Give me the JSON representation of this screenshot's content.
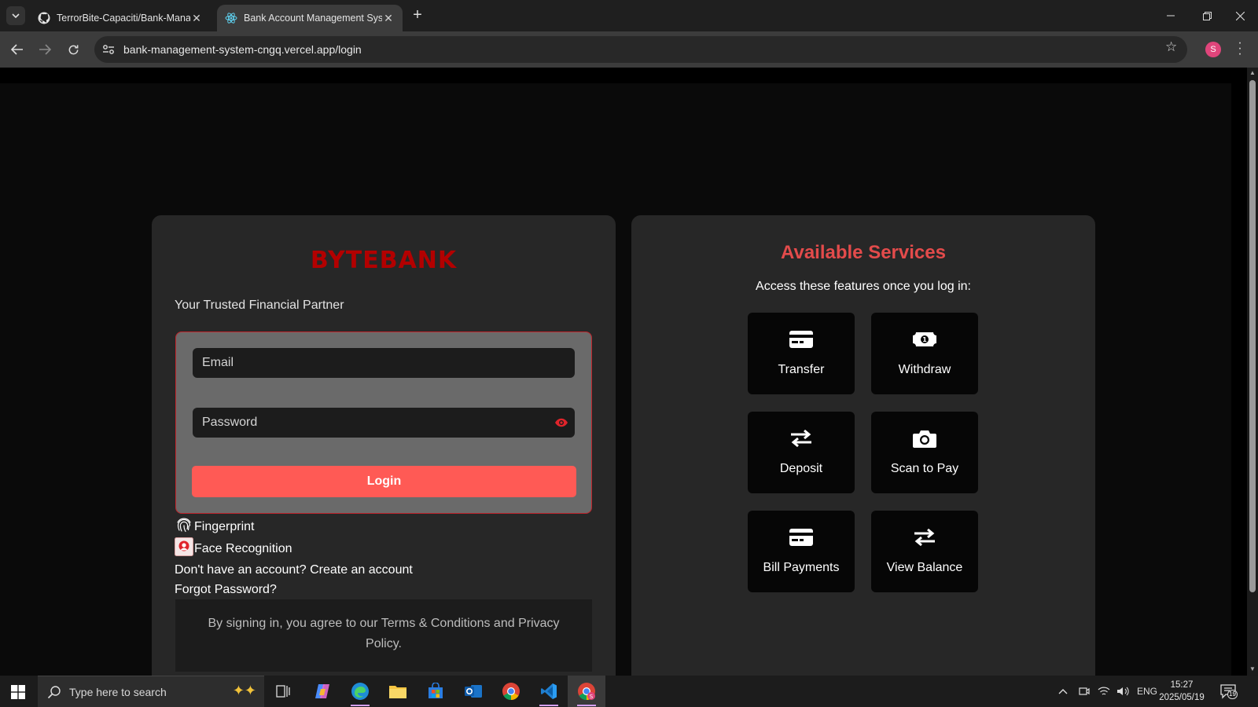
{
  "browser": {
    "tabs": [
      {
        "title": "TerrorBite-Capaciti/Bank-Mana",
        "icon": "github-icon",
        "active": false
      },
      {
        "title": "Bank Account Management Sys",
        "icon": "react-icon",
        "active": true
      }
    ],
    "address": "bank-management-system-cngq.vercel.app/login",
    "profile_initial": "S",
    "new_tab_symbol": "+"
  },
  "login": {
    "brand": "BYTEBANK",
    "tagline": "Your Trusted Financial Partner",
    "email_placeholder": "Email",
    "email_value": "",
    "password_placeholder": "Password",
    "password_value": "",
    "login_button": "Login",
    "fingerprint_label": "Fingerprint",
    "face_label": "Face Recognition",
    "signup_prompt": "Don't have an account? Create an account",
    "forgot_password": "Forgot Password?",
    "terms": "By signing in, you agree to our Terms & Conditions and Privacy Policy."
  },
  "services": {
    "title": "Available Services",
    "subtitle": "Access these features once you log in:",
    "items": [
      {
        "label": "Transfer",
        "icon": "credit-card-icon"
      },
      {
        "label": "Withdraw",
        "icon": "money-bill-icon"
      },
      {
        "label": "Deposit",
        "icon": "exchange-arrows-icon"
      },
      {
        "label": "Scan to Pay",
        "icon": "camera-icon"
      },
      {
        "label": "Bill Payments",
        "icon": "credit-card-icon"
      },
      {
        "label": "View Balance",
        "icon": "exchange-arrows-icon"
      }
    ]
  },
  "taskbar": {
    "search_placeholder": "Type here to search",
    "time": "15:27",
    "date": "2025/05/19",
    "language": "ENG",
    "notification_count": "19"
  },
  "colors": {
    "brand": "#b30000",
    "accent": "#ff5a55",
    "services_title": "#e34b4b",
    "card_bg": "#272727"
  }
}
